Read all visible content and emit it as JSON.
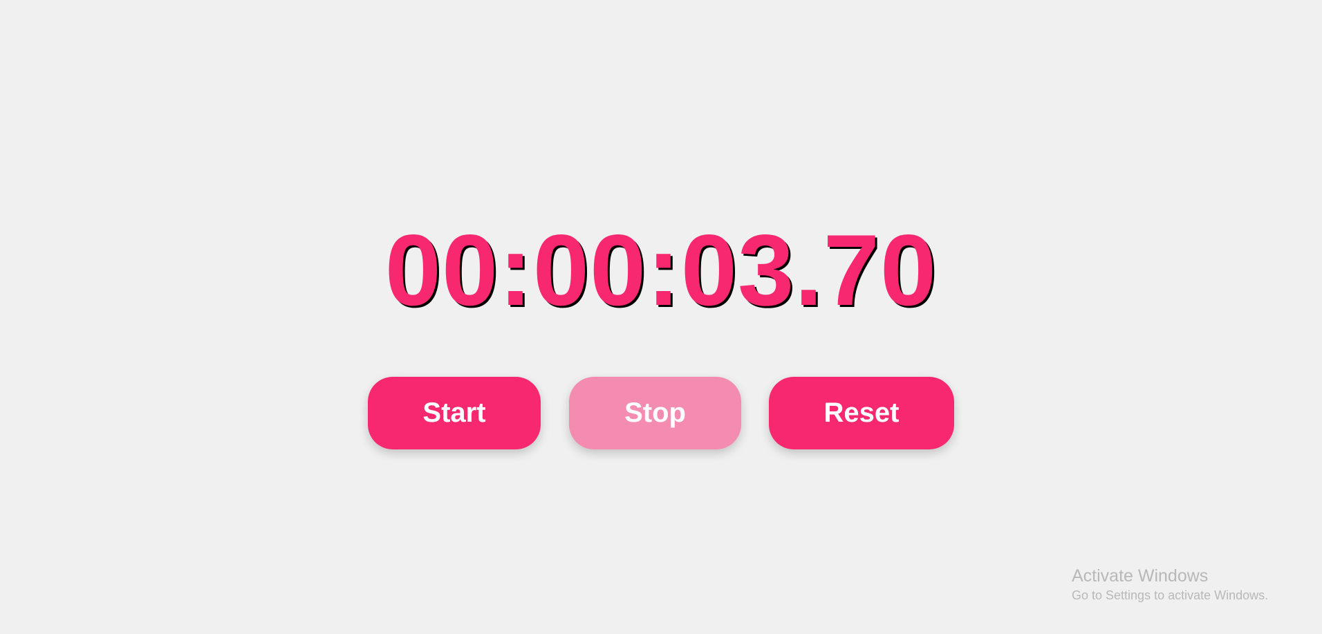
{
  "stopwatch": {
    "time": "00:00:03.70",
    "buttons": {
      "start_label": "Start",
      "stop_label": "Stop",
      "reset_label": "Reset"
    },
    "stop_disabled": true
  },
  "watermark": {
    "title": "Activate Windows",
    "subtitle": "Go to Settings to activate Windows."
  },
  "colors": {
    "background": "#f0f0f0",
    "accent": "#f72870",
    "accent_disabled": "#f48bb0",
    "shadow": "#000000",
    "button_text": "#ffffff",
    "watermark": "#b8b8b8"
  }
}
